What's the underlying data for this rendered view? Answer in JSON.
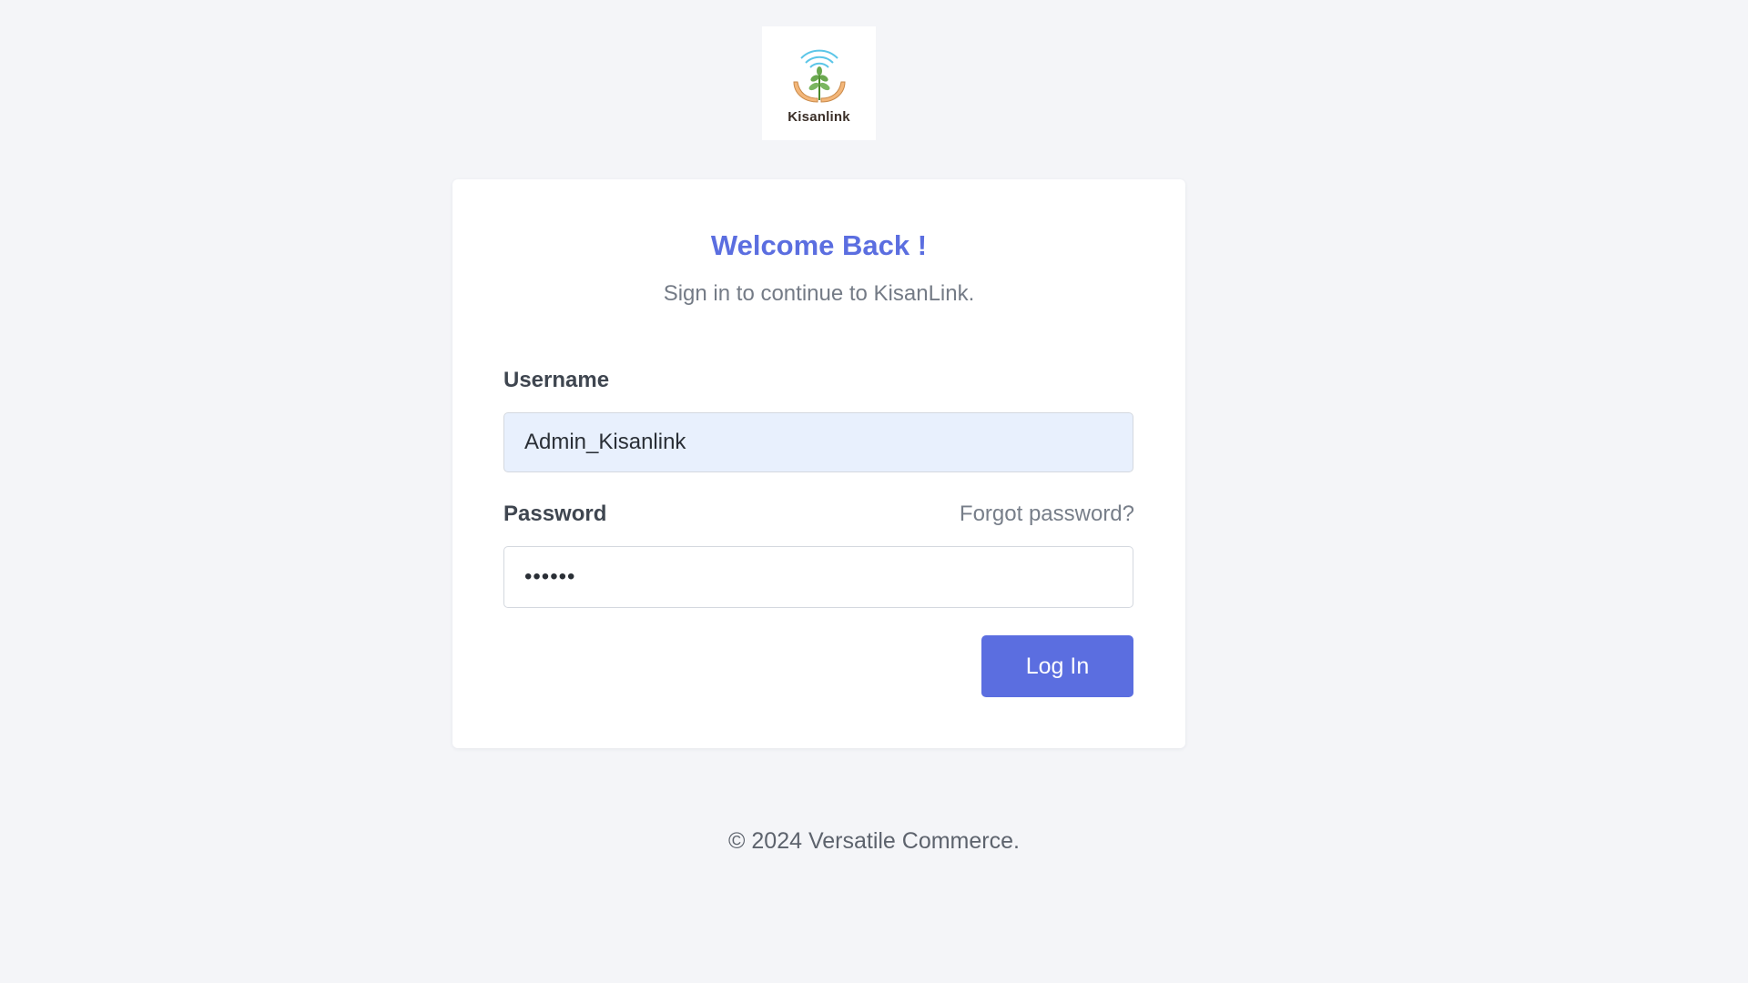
{
  "brand": {
    "logo_text": "Kisanlink",
    "logo_icon": "plant-in-hands-icon"
  },
  "login": {
    "title": "Welcome Back !",
    "subtitle": "Sign in to continue to KisanLink.",
    "username_label": "Username",
    "username_value": "Admin_Kisanlink",
    "password_label": "Password",
    "password_value": "••••••",
    "forgot_password": "Forgot password?",
    "submit_label": "Log In"
  },
  "footer": {
    "copyright": "© 2024 Versatile Commerce."
  },
  "colors": {
    "accent": "#5b6ee0",
    "background": "#f4f5f8",
    "username_field_bg": "#e8f0fd"
  }
}
